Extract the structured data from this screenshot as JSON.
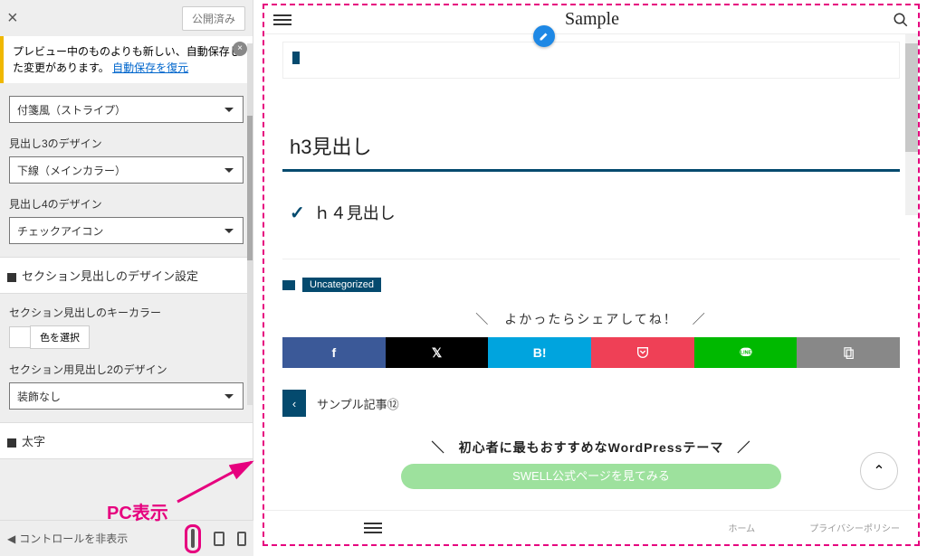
{
  "sidebar": {
    "publish_label": "公開済み",
    "notice_text": "プレビュー中のものよりも新しい、自動保存した変更があります。",
    "restore_link": "自動保存を復元",
    "h2_select": "付箋風（ストライプ）",
    "h3_label": "見出し3のデザイン",
    "h3_select": "下線（メインカラー）",
    "h4_label": "見出し4のデザイン",
    "h4_select": "チェックアイコン",
    "section_design_head": "セクション見出しのデザイン設定",
    "keycolor_label": "セクション見出しのキーカラー",
    "keycolor_btn": "色を選択",
    "sec_h2_label": "セクション用見出し2のデザイン",
    "sec_h2_select": "装飾なし",
    "bold_head": "太字",
    "hide_controls": "コントロールを非表示"
  },
  "annotation": "PC表示",
  "preview": {
    "site_title": "Sample",
    "h3": "h3見出し",
    "h4": "ｈ４見出し",
    "category": "Uncategorized",
    "share_title": "＼　よかったらシェアしてね！　／",
    "hatena": "B!",
    "prev_post": "サンプル記事⑫",
    "cta_title": "＼　初心者に最もおすすめなWordPressテーマ　／",
    "cta_btn": "SWELL公式ページを見てみる",
    "footer_home": "ホーム",
    "footer_privacy": "プライバシーポリシー",
    "footer_menu": "メニュー"
  }
}
